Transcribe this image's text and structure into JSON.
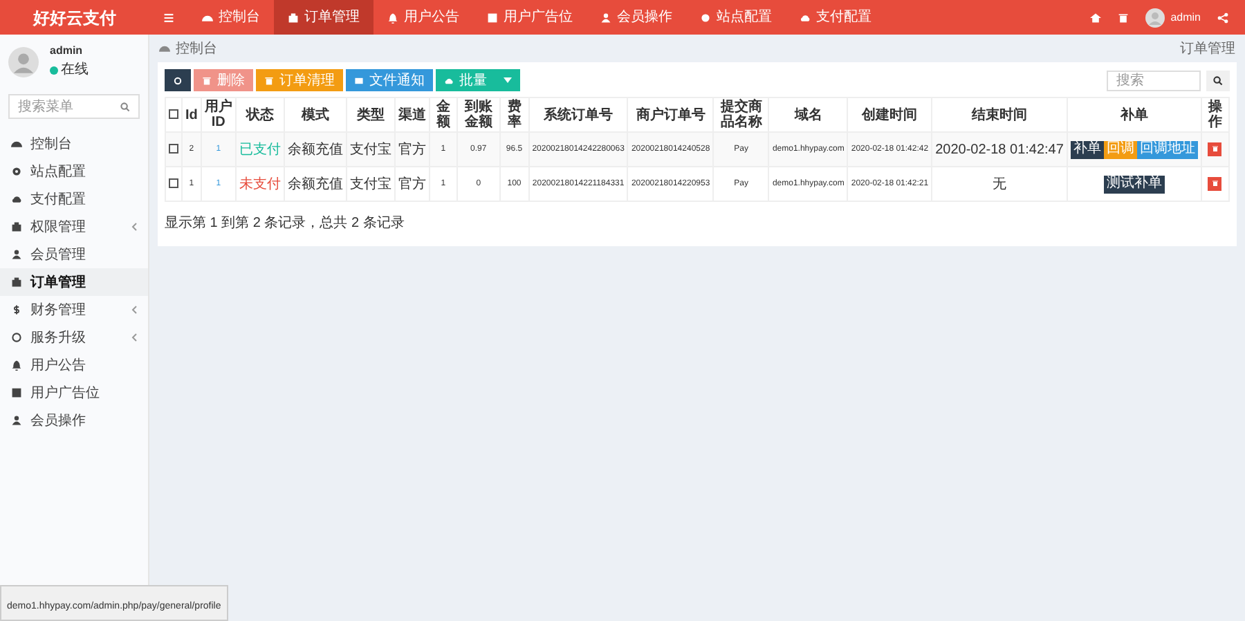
{
  "logo": "好好云支付",
  "top_nav": [
    {
      "kind": "menu",
      "selected": false
    },
    {
      "kind": "dashboard",
      "label": "控制台",
      "selected": false
    },
    {
      "kind": "box",
      "label": "订单管理",
      "selected": true
    },
    {
      "kind": "bell",
      "label": "用户公告",
      "selected": false
    },
    {
      "kind": "doc",
      "label": "用户广告位",
      "selected": false
    },
    {
      "kind": "user",
      "label": "会员操作",
      "selected": false
    },
    {
      "kind": "gear",
      "label": "站点配置",
      "selected": false
    },
    {
      "kind": "cloud",
      "label": "支付配置",
      "selected": false
    }
  ],
  "top_right": {
    "user": "admin"
  },
  "sidebar": {
    "user": "admin",
    "status": "在线",
    "search_placeholder": "搜索菜单",
    "items": [
      {
        "kind": "dashboard",
        "label": "控制台",
        "selected": false,
        "expandable": false
      },
      {
        "kind": "gear",
        "label": "站点配置",
        "selected": false,
        "expandable": false
      },
      {
        "kind": "cloud",
        "label": "支付配置",
        "selected": false,
        "expandable": false
      },
      {
        "kind": "box",
        "label": "权限管理",
        "selected": false,
        "expandable": true
      },
      {
        "kind": "user",
        "label": "会员管理",
        "selected": false,
        "expandable": false
      },
      {
        "kind": "box",
        "label": "订单管理",
        "selected": true,
        "expandable": false
      },
      {
        "kind": "dollar",
        "label": "财务管理",
        "selected": false,
        "expandable": true
      },
      {
        "kind": "circle",
        "label": "服务升级",
        "selected": false,
        "expandable": true
      },
      {
        "kind": "bell",
        "label": "用户公告",
        "selected": false,
        "expandable": false
      },
      {
        "kind": "doc",
        "label": "用户广告位",
        "selected": false,
        "expandable": false
      },
      {
        "kind": "user",
        "label": "会员操作",
        "selected": false,
        "expandable": false
      }
    ]
  },
  "breadcrumb": "控制台",
  "page_title": "订单管理",
  "toolbar": [
    {
      "kind": "refresh",
      "disabled": false
    },
    {
      "kind": "delete",
      "label": "删除",
      "disabled": true
    },
    {
      "kind": "clean",
      "label": "订单清理",
      "disabled": false
    },
    {
      "kind": "notify",
      "label": "文件通知",
      "disabled": false
    },
    {
      "kind": "batch",
      "label": "批量",
      "disabled": false
    }
  ],
  "search_placeholder": "搜索",
  "table": {
    "all_checked": false,
    "columns": [
      "Id",
      "用户ID",
      "状态",
      "模式",
      "类型",
      "渠道",
      "金额",
      "到账金额",
      "费率",
      "系统订单号",
      "商户订单号",
      "提交商品名称",
      "域名",
      "创建时间",
      "结束时间",
      "补单",
      "操作"
    ],
    "rows": [
      {
        "checked": false,
        "cells": [
          "2",
          "1",
          "已支付",
          "余额充值",
          "支付宝",
          "官方",
          "1",
          "0.97",
          "96.5",
          "20200218014242280063",
          "20200218014240528",
          "Pay",
          "demo1.hhypay.com",
          "2020-02-18 01:42:42",
          "2020-02-18 01:42:47"
        ],
        "paid": true,
        "actions": [
          {
            "kind": "dark",
            "label": "补单"
          },
          {
            "kind": "warn",
            "label": "回调"
          },
          {
            "kind": "info",
            "label": "回调地址"
          }
        ]
      },
      {
        "checked": false,
        "cells": [
          "1",
          "1",
          "未支付",
          "余额充值",
          "支付宝",
          "官方",
          "1",
          "0",
          "100",
          "20200218014221184331",
          "20200218014220953",
          "Pay",
          "demo1.hhypay.com",
          "2020-02-18 01:42:21",
          "无"
        ],
        "paid": false,
        "actions": [
          {
            "kind": "dark",
            "label": "测试补单"
          }
        ]
      }
    ]
  },
  "pagination_info": "显示第 1 到第 2 条记录，总共 2 条记录",
  "status_url": "demo1.hhypay.com/admin.php/pay/general/profile"
}
